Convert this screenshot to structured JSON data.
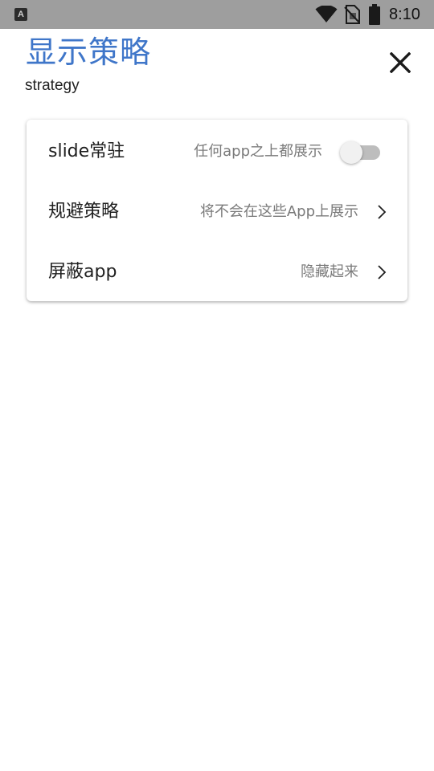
{
  "status_bar": {
    "app_icon_letter": "A",
    "time": "8:10",
    "icons": [
      "wifi-icon",
      "no-sim-icon",
      "battery-icon"
    ]
  },
  "header": {
    "title": "显示策略",
    "subtitle": "strategy",
    "close_icon": "close-icon"
  },
  "settings": {
    "rows": [
      {
        "label": "slide常驻",
        "description": "任何app之上都展示",
        "control": "toggle",
        "toggle_on": false
      },
      {
        "label": "规避策略",
        "description": "将不会在这些App上展示",
        "control": "chevron"
      },
      {
        "label": "屏蔽app",
        "description": "隐藏起来",
        "control": "chevron"
      }
    ]
  },
  "colors": {
    "status_bar_bg": "#9e9e9e",
    "title_color": "#3f76c9",
    "toggle_off_track": "#bdbdbd",
    "toggle_off_thumb": "#f1f1f1"
  }
}
